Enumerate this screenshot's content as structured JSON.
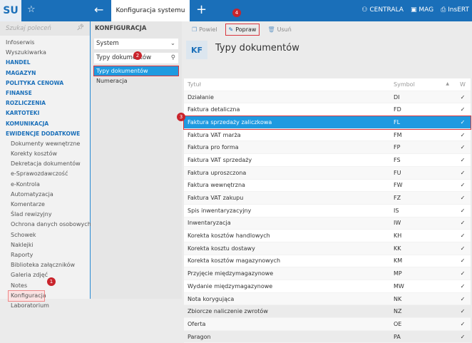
{
  "topbar": {
    "logo": "SU",
    "tab": "Konfiguracja systemu",
    "right": [
      "CENTRALA",
      "MAG",
      "InsERT"
    ]
  },
  "sidebar": {
    "search_placeholder": "Szukaj poleceń",
    "items": [
      {
        "label": "Infoserwis",
        "type": "item"
      },
      {
        "label": "Wyszukiwarka",
        "type": "item"
      },
      {
        "label": "HANDEL",
        "type": "sec"
      },
      {
        "label": "MAGAZYN",
        "type": "sec"
      },
      {
        "label": "POLITYKA CENOWA",
        "type": "sec"
      },
      {
        "label": "FINANSE",
        "type": "sec"
      },
      {
        "label": "ROZLICZENIA",
        "type": "sec"
      },
      {
        "label": "KARTOTEKI",
        "type": "sec"
      },
      {
        "label": "KOMUNIKACJA",
        "type": "sec"
      },
      {
        "label": "EWIDENCJE DODATKOWE",
        "type": "sec"
      },
      {
        "label": "Dokumenty wewnętrzne",
        "type": "sub"
      },
      {
        "label": "Korekty kosztów",
        "type": "sub"
      },
      {
        "label": "Dekretacja dokumentów",
        "type": "sub"
      },
      {
        "label": "e-Sprawozdawczość",
        "type": "sub"
      },
      {
        "label": "e-Kontrola",
        "type": "sub"
      },
      {
        "label": "Automatyzacja",
        "type": "sub"
      },
      {
        "label": "Komentarze",
        "type": "sub"
      },
      {
        "label": "Ślad rewizyjny",
        "type": "sub"
      },
      {
        "label": "Ochrona danych osobowych",
        "type": "sub"
      },
      {
        "label": "Schowek",
        "type": "sub"
      },
      {
        "label": "Naklejki",
        "type": "sub"
      },
      {
        "label": "Raporty",
        "type": "sub"
      },
      {
        "label": "Biblioteka załączników",
        "type": "sub"
      },
      {
        "label": "Galeria zdjęć",
        "type": "sub"
      },
      {
        "label": "Notes",
        "type": "sub"
      },
      {
        "label": "Konfiguracja",
        "type": "sub"
      },
      {
        "label": "Laboratorium",
        "type": "sub"
      }
    ]
  },
  "config": {
    "heading": "KONFIGURACJA",
    "select": "System",
    "search": "Typy dokumentów",
    "items": [
      "Typy dokumentów",
      "Numeracja"
    ]
  },
  "toolbar": {
    "duplicate": "Powiel",
    "edit": "Popraw",
    "delete": "Usuń"
  },
  "main": {
    "badge": "KF",
    "title": "Typy dokumentów",
    "columns": [
      "Tytuł",
      "Symbol",
      "W"
    ],
    "rows": [
      [
        "Działanie",
        "DI"
      ],
      [
        "Faktura detaliczna",
        "FD"
      ],
      [
        "Faktura sprzedaży zaliczkowa",
        "FL"
      ],
      [
        "Faktura VAT marża",
        "FM"
      ],
      [
        "Faktura pro forma",
        "FP"
      ],
      [
        "Faktura VAT sprzedaży",
        "FS"
      ],
      [
        "Faktura uproszczona",
        "FU"
      ],
      [
        "Faktura wewnętrzna",
        "FW"
      ],
      [
        "Faktura VAT zakupu",
        "FZ"
      ],
      [
        "Spis inwentaryzacyjny",
        "IS"
      ],
      [
        "Inwentaryzacja",
        "IW"
      ],
      [
        "Korekta kosztów handlowych",
        "KH"
      ],
      [
        "Korekta kosztu dostawy",
        "KK"
      ],
      [
        "Korekta kosztów magazynowych",
        "KM"
      ],
      [
        "Przyjęcie międzymagazynowe",
        "MP"
      ],
      [
        "Wydanie międzymagazynowe",
        "MW"
      ],
      [
        "Nota korygująca",
        "NK"
      ],
      [
        "Zbiorcze naliczenie zwrotów",
        "NZ"
      ],
      [
        "Oferta",
        "OE"
      ],
      [
        "Paragon",
        "PA"
      ]
    ],
    "check": "✓"
  },
  "steps": [
    "1",
    "2",
    "3",
    "4"
  ]
}
